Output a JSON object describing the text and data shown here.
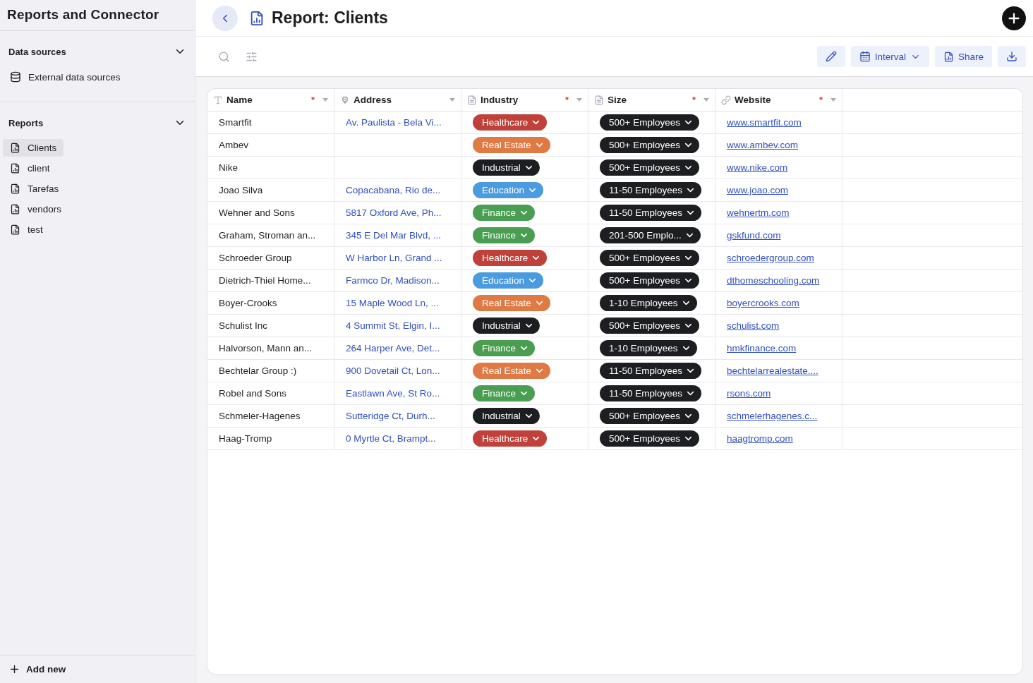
{
  "app_title": "Reports and Connector",
  "sidebar": {
    "sections": [
      {
        "title": "Data sources",
        "expanded": true,
        "items": [
          {
            "label": "External data sources",
            "kind": "database",
            "selected": false
          }
        ]
      },
      {
        "title": "Reports",
        "expanded": true,
        "items": [
          {
            "label": "Clients",
            "kind": "report",
            "selected": true
          },
          {
            "label": "client",
            "kind": "report",
            "selected": false
          },
          {
            "label": "Tarefas",
            "kind": "report",
            "selected": false
          },
          {
            "label": "vendors",
            "kind": "report",
            "selected": false
          },
          {
            "label": "test",
            "kind": "report",
            "selected": false
          }
        ]
      }
    ],
    "add_new": "Add new"
  },
  "page_title": "Report: Clients",
  "toolbar": {
    "buttons": [
      {
        "kind": "edit"
      },
      {
        "kind": "interval",
        "label": "Interval"
      },
      {
        "kind": "share",
        "label": "Share"
      },
      {
        "kind": "download"
      }
    ]
  },
  "table": {
    "columns": [
      {
        "label": "Name",
        "kind": "text",
        "required_mark": "*",
        "sortable": true
      },
      {
        "label": "Address",
        "kind": "location",
        "sortable": true
      },
      {
        "label": "Industry",
        "kind": "select",
        "required_mark": "*",
        "sortable": true
      },
      {
        "label": "Size",
        "kind": "select",
        "required_mark": "*",
        "sortable": true
      },
      {
        "label": "Website",
        "kind": "link",
        "required_mark": "*",
        "sortable": true
      }
    ],
    "rows": [
      {
        "name": "Smartfit",
        "address": "Av. Paulista - Bela Vi...",
        "industry": {
          "label": "Healthcare",
          "color": "#c0403a"
        },
        "size": "500+ Employees",
        "website": "www.smartfit.com"
      },
      {
        "name": "Ambev",
        "industry": {
          "label": "Real Estate",
          "color": "#e07a45"
        },
        "size": "500+ Employees",
        "website": "www.ambev.com"
      },
      {
        "name": "Nike",
        "industry": {
          "label": "Industrial",
          "color": "#1d1e22"
        },
        "size": "500+ Employees",
        "website": "www.nike.com"
      },
      {
        "name": "Joao Silva",
        "address": "Copacabana, Rio de...",
        "industry": {
          "label": "Education",
          "color": "#4a9be0"
        },
        "size": "11-50 Employees",
        "website": "www.joao.com"
      },
      {
        "name": "Wehner and Sons",
        "address": "5817 Oxford Ave, Ph...",
        "industry": {
          "label": "Finance",
          "color": "#4a9e52"
        },
        "size": "11-50 Employees",
        "website": "wehnertm.com"
      },
      {
        "name": "Graham, Stroman an...",
        "address": "345 E Del Mar Blvd, ...",
        "industry": {
          "label": "Finance",
          "color": "#4a9e52"
        },
        "size": "201-500 Emplo...",
        "website": "gskfund.com"
      },
      {
        "name": "Schroeder Group",
        "address": "W Harbor Ln, Grand ...",
        "industry": {
          "label": "Healthcare",
          "color": "#c0403a"
        },
        "size": "500+ Employees",
        "website": "schroedergroup.com"
      },
      {
        "name": "Dietrich-Thiel Home...",
        "address": "Farmco Dr, Madison...",
        "industry": {
          "label": "Education",
          "color": "#4a9be0"
        },
        "size": "500+ Employees",
        "website": "dthomeschooling.com"
      },
      {
        "name": "Boyer-Crooks",
        "address": "15 Maple Wood Ln, ...",
        "industry": {
          "label": "Real Estate",
          "color": "#e07a45"
        },
        "size": "1-10 Employees",
        "website": "boyercrooks.com"
      },
      {
        "name": "Schulist Inc",
        "address": "4 Summit St, Elgin, I...",
        "industry": {
          "label": "Industrial",
          "color": "#1d1e22"
        },
        "size": "500+ Employees",
        "website": "schulist.com"
      },
      {
        "name": "Halvorson, Mann an...",
        "address": "264 Harper Ave, Det...",
        "industry": {
          "label": "Finance",
          "color": "#4a9e52"
        },
        "size": "1-10 Employees",
        "website": "hmkfinance.com"
      },
      {
        "name": "Bechtelar Group :)",
        "address": "900 Dovetail Ct, Lon...",
        "industry": {
          "label": "Real Estate",
          "color": "#e07a45"
        },
        "size": "11-50 Employees",
        "website": "bechtelarrealestate...."
      },
      {
        "name": "Robel and Sons",
        "address": "Eastlawn Ave, St Ro...",
        "industry": {
          "label": "Finance",
          "color": "#4a9e52"
        },
        "size": "11-50 Employees",
        "website": "rsons.com"
      },
      {
        "name": "Schmeler-Hagenes",
        "address": "Sutteridge Ct, Durh...",
        "industry": {
          "label": "Industrial",
          "color": "#1d1e22"
        },
        "size": "500+ Employees",
        "website": "schmelerhagenes.c..."
      },
      {
        "name": "Haag-Tromp",
        "address": "0 Myrtle Ct, Brampt...",
        "industry": {
          "label": "Healthcare",
          "color": "#c0403a"
        },
        "size": "500+ Employees",
        "website": "haagtromp.com"
      }
    ]
  }
}
